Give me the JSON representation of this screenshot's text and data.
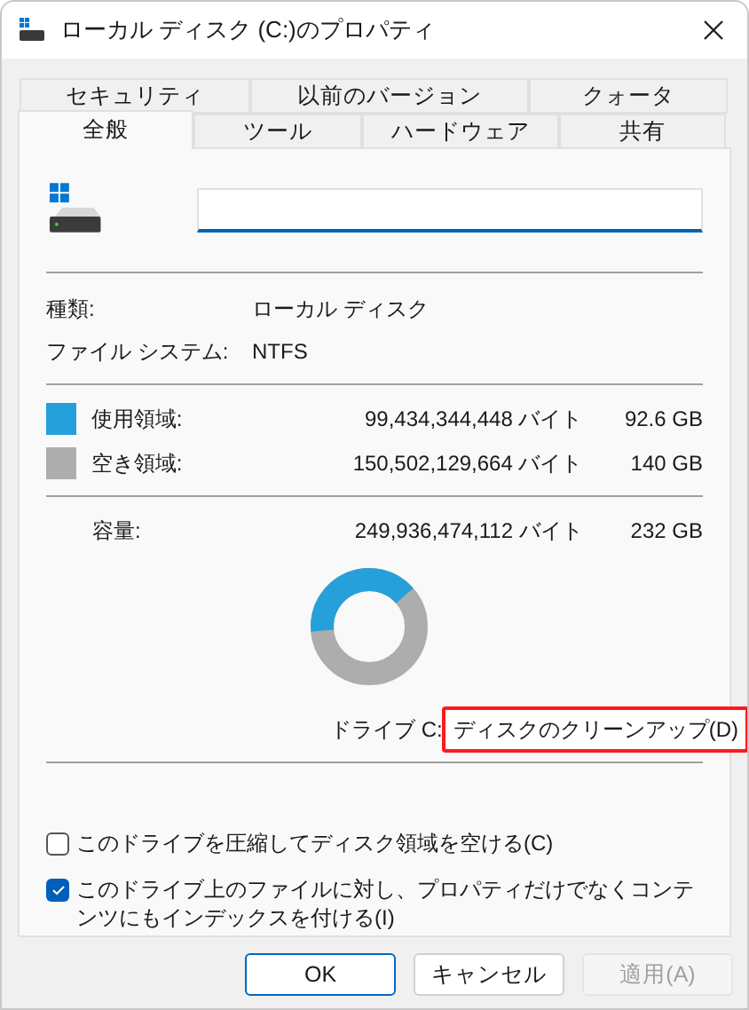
{
  "window": {
    "title": "ローカル ディスク (C:)のプロパティ"
  },
  "tab_rows": [
    [
      {
        "label": "セキュリティ",
        "selected": false
      },
      {
        "label": "以前のバージョン",
        "selected": false
      },
      {
        "label": "クォータ",
        "selected": false
      }
    ],
    [
      {
        "label": "全般",
        "selected": true
      },
      {
        "label": "ツール",
        "selected": false
      },
      {
        "label": "ハードウェア",
        "selected": false
      },
      {
        "label": "共有",
        "selected": false
      }
    ]
  ],
  "info": [
    {
      "label": "種類:",
      "value": "ローカル ディスク"
    },
    {
      "label": "ファイル システム:",
      "value": "NTFS"
    }
  ],
  "space": [
    {
      "label": "使用領域:",
      "bytes": "99,434,344,448 バイト",
      "size": "92.6 GB",
      "color": "#26a0da"
    },
    {
      "label": "空き領域:",
      "bytes": "150,502,129,664 バイト",
      "size": "140 GB",
      "color": "#adadad"
    }
  ],
  "capacity": {
    "label": "容量:",
    "bytes": "249,936,474,112 バイト",
    "size": "232 GB"
  },
  "usage_chart": {
    "level": 0.4
  },
  "drive_label": "ドライブ C:",
  "cleanup_button": {
    "label": "ディスクのクリーンアップ(D)",
    "highlighted": true
  },
  "options": [
    {
      "label": "このドライブを圧縮してディスク領域を空ける(C)",
      "checked": false
    },
    {
      "label": "このドライブ上のファイルに対し、プロパティだけでなくコンテンツにもインデックスを付ける(I)",
      "checked": true
    }
  ],
  "buttons": [
    {
      "label": "OK",
      "kind": "default",
      "disabled": false
    },
    {
      "label": "キャンセル",
      "kind": "normal",
      "disabled": false
    },
    {
      "label": "適用(A)",
      "kind": "normal",
      "disabled": true
    }
  ]
}
